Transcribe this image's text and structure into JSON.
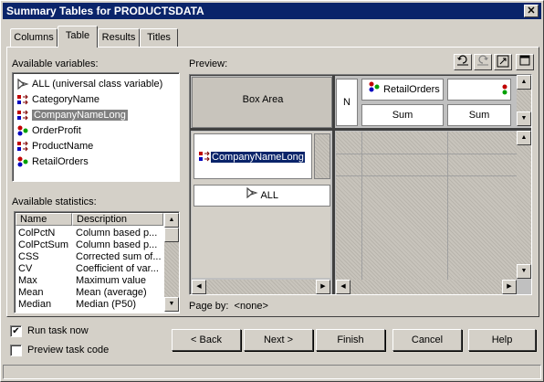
{
  "window": {
    "title": "Summary Tables for PRODUCTSDATA",
    "close_glyph": "✕"
  },
  "tabs": [
    {
      "label": "Columns"
    },
    {
      "label": "Table",
      "active": true
    },
    {
      "label": "Results"
    },
    {
      "label": "Titles"
    }
  ],
  "variables": {
    "label": "Available variables:",
    "items": [
      {
        "label": "ALL (universal class variable)",
        "icon": "all-class-icon"
      },
      {
        "label": "CategoryName",
        "icon": "class-variable-icon"
      },
      {
        "label": "CompanyNameLong",
        "icon": "class-variable-icon",
        "selected": true
      },
      {
        "label": "OrderProfit",
        "icon": "analysis-variable-icon"
      },
      {
        "label": "ProductName",
        "icon": "class-variable-icon"
      },
      {
        "label": "RetailOrders",
        "icon": "analysis-variable-icon"
      }
    ]
  },
  "statistics": {
    "label": "Available statistics:",
    "columns": [
      "Name",
      "Description"
    ],
    "rows": [
      [
        "ColPctN",
        "Column based p..."
      ],
      [
        "ColPctSum",
        "Column based p..."
      ],
      [
        "CSS",
        "Corrected sum of..."
      ],
      [
        "CV",
        "Coefficient of var..."
      ],
      [
        "Max",
        "Maximum value"
      ],
      [
        "Mean",
        "Mean (average)"
      ],
      [
        "Median",
        "Median (P50)"
      ]
    ]
  },
  "preview": {
    "label": "Preview:",
    "box_area": "Box Area",
    "n_label": "N",
    "column_var": "RetailOrders",
    "sum_labels": [
      "Sum",
      "Sum"
    ],
    "row_var": "CompanyNameLong",
    "all_label": "ALL",
    "page_by_label": "Page by:",
    "page_by_value": "<none>",
    "toolbar_icons": [
      "undo-icon",
      "redo-icon",
      "swap-icon",
      "maximize-icon"
    ]
  },
  "options": {
    "run_task_now": {
      "label": "Run task now",
      "checked": true
    },
    "preview_code": {
      "label": "Preview task code",
      "checked": false
    }
  },
  "buttons": {
    "back": "< Back",
    "next": "Next >",
    "finish": "Finish",
    "cancel": "Cancel",
    "help": "Help"
  }
}
